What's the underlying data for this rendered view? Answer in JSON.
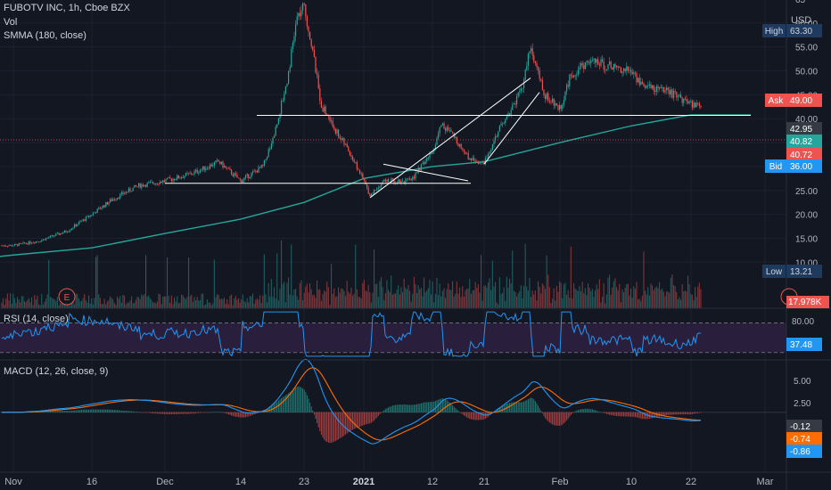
{
  "header": {
    "symbol_line": "FUBOTV INC, 1h, Cboe BZX",
    "volume_label": "Vol",
    "ma_label": "SMMA (180, close)",
    "rsi_label": "RSI (14, close)",
    "macd_label": "MACD (12, 26, close, 9)",
    "currency": "USD"
  },
  "colors": {
    "background": "#131722",
    "up": "#26a69a",
    "down": "#ef5350",
    "smma": "#26a69a",
    "rsi": "#2196f3",
    "rsi_band": "#2a1e3d",
    "macd": "#2196f3",
    "signal": "#ff6d00",
    "drawings": "#ffffff"
  },
  "x_axis": {
    "labels": [
      "Nov",
      "16",
      "Dec",
      "14",
      "23",
      "2021",
      "12",
      "21",
      "Feb",
      "10",
      "22",
      "Mar"
    ],
    "bold_label": "2021"
  },
  "price_axis": {
    "ticks": [
      "65",
      "60.00",
      "55.00",
      "50.00",
      "45.00",
      "40.00",
      "35.00",
      "30.00",
      "25.00",
      "20.00",
      "15.00",
      "10.00"
    ]
  },
  "price_badges": {
    "high": {
      "label": "High",
      "value": "63.30"
    },
    "ask": {
      "label": "Ask",
      "value": "49.00"
    },
    "last": {
      "value": "42.95"
    },
    "smma_value": {
      "value": "40.82"
    },
    "prev": {
      "value": "40.72"
    },
    "bid": {
      "label": "Bid",
      "value": "36.00"
    },
    "low": {
      "label": "Low",
      "value": "13.21"
    },
    "volume": {
      "value": "17.978K"
    }
  },
  "event_marker": "E",
  "rsi_axis": {
    "ticks": [
      "80.00"
    ],
    "value": "37.48"
  },
  "macd_axis": {
    "ticks": [
      "5.00",
      "2.50"
    ],
    "macd_value": "-0.12",
    "signal_value": "-0.74",
    "hist_value": "-0.86"
  },
  "chart_data": {
    "type": "candlestick",
    "title": "FUBOTV INC, 1h, Cboe BZX",
    "price_unit": "USD",
    "price_range": [
      5,
      66
    ],
    "price_path": [
      [
        "Nov",
        13.5
      ],
      [
        "Nov 7",
        14.5
      ],
      [
        "Nov 12",
        16.5
      ],
      [
        "16",
        20
      ],
      [
        "Nov 20",
        23
      ],
      [
        "Nov 25",
        26
      ],
      [
        "Dec",
        27
      ],
      [
        "Dec 7",
        28.5
      ],
      [
        "Dec 10",
        31
      ],
      [
        "14",
        27
      ],
      [
        "Dec 17",
        30
      ],
      [
        "Dec 19",
        37
      ],
      [
        "Dec 21",
        48
      ],
      [
        "Dec 22",
        61
      ],
      [
        "23",
        63.3
      ],
      [
        "Dec 24",
        55
      ],
      [
        "Dec 26",
        43
      ],
      [
        "Dec 28",
        38
      ],
      [
        "Dec 30",
        33
      ],
      [
        "2021",
        27
      ],
      [
        "Jan 3",
        24
      ],
      [
        "Jan 6",
        27
      ],
      [
        "Jan 10",
        27
      ],
      [
        "12",
        33
      ],
      [
        "Jan 14",
        39
      ],
      [
        "Jan 17",
        36
      ],
      [
        "Jan 19",
        32
      ],
      [
        "21",
        30.5
      ],
      [
        "Jan 23",
        36
      ],
      [
        "Jan 25",
        41
      ],
      [
        "Jan 27",
        46
      ],
      [
        "Jan 28",
        55
      ],
      [
        "Jan 30",
        45
      ],
      [
        "Feb",
        42
      ],
      [
        "Feb 4",
        49
      ],
      [
        "Feb 7",
        52
      ],
      [
        "10",
        50
      ],
      [
        "Feb 14",
        47
      ],
      [
        "Feb 18",
        46
      ],
      [
        "22",
        43
      ],
      [
        "Feb 23",
        42.95
      ]
    ],
    "smma_path": [
      [
        "Nov",
        11.5
      ],
      [
        "16",
        13
      ],
      [
        "Dec",
        16
      ],
      [
        "14",
        19
      ],
      [
        "23",
        22.5
      ],
      [
        "2021",
        27.5
      ],
      [
        "12",
        30
      ],
      [
        "21",
        31
      ],
      [
        "Feb",
        35
      ],
      [
        "10",
        38.5
      ],
      [
        "22",
        40.8
      ]
    ],
    "trendlines": [
      {
        "from": [
          "Dec 18",
          40.7
        ],
        "to": [
          "Feb 26",
          40.7
        ]
      },
      {
        "from": [
          "Dec",
          26.5
        ],
        "to": [
          "Jan 20",
          26.5
        ]
      },
      {
        "from": [
          "Jan 3",
          23.5
        ],
        "to": [
          "Jan 28",
          48.5
        ]
      },
      {
        "from": [
          "21",
          30.5
        ],
        "to": [
          "Jan 29",
          45.5
        ]
      },
      {
        "from": [
          "Jan 6",
          30.5
        ],
        "to": [
          "Jan 19",
          27
        ]
      }
    ],
    "rsi": {
      "range": [
        20,
        90
      ],
      "band": [
        30,
        70
      ],
      "last": 37.48
    },
    "macd": {
      "range": [
        -8,
        7
      ],
      "last_macd": -0.12,
      "last_signal": -0.74,
      "last_hist": -0.86
    }
  }
}
